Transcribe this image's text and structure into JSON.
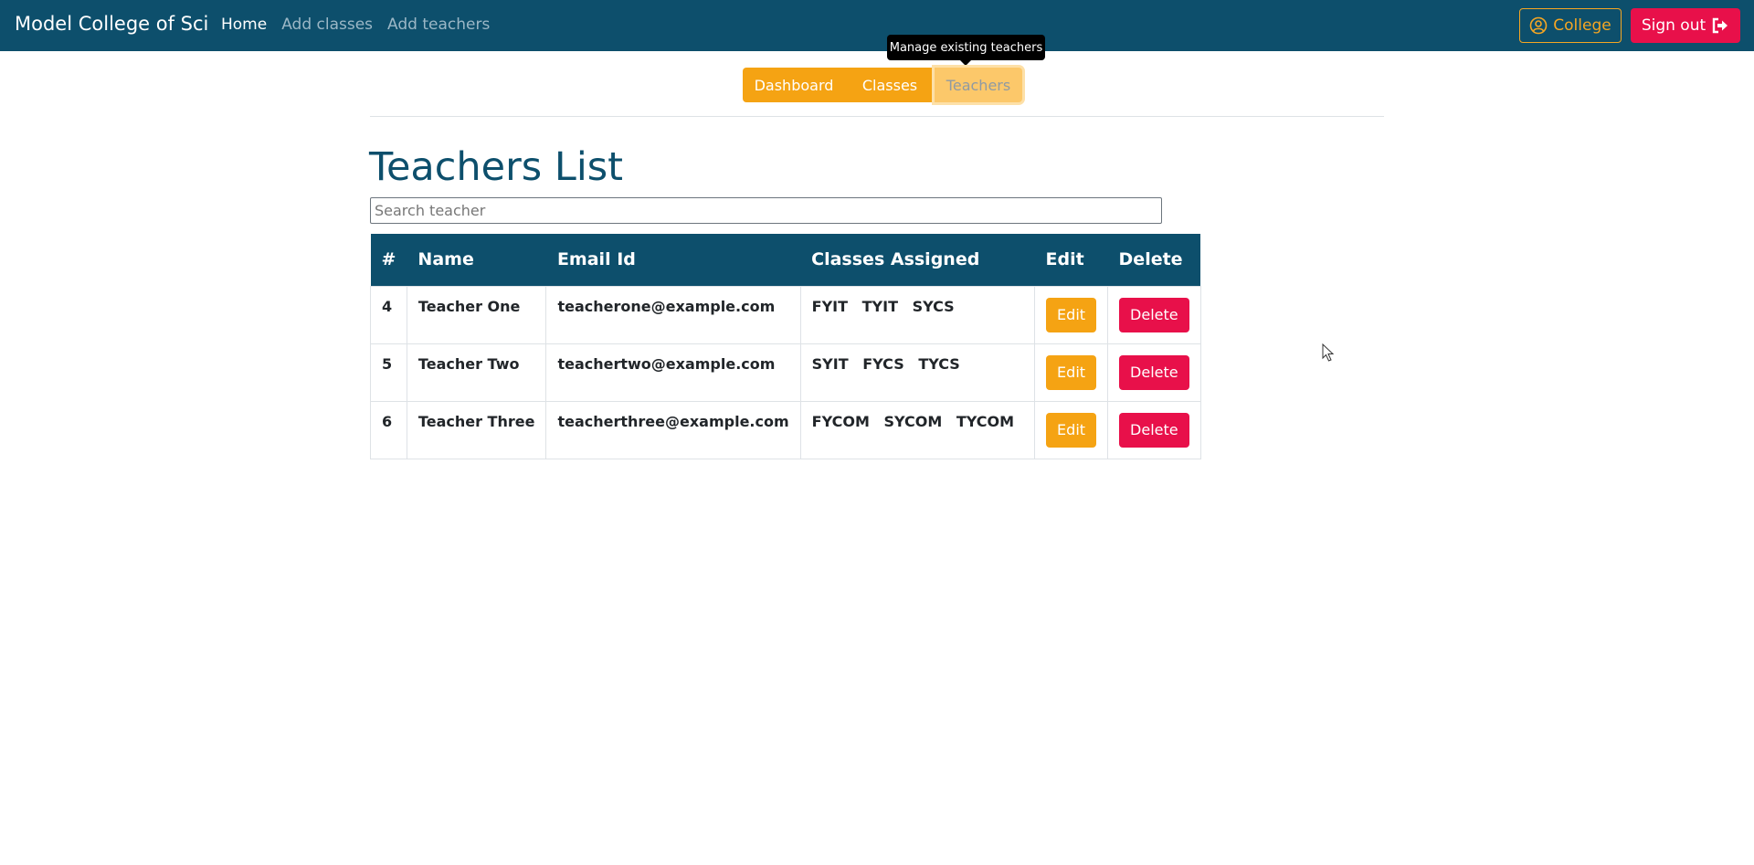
{
  "navbar": {
    "brand": "Model College of Sci",
    "links": [
      {
        "label": "Home",
        "active": true
      },
      {
        "label": "Add classes",
        "active": false
      },
      {
        "label": "Add teachers",
        "active": false
      }
    ],
    "college_button": {
      "label": "College",
      "icon": "user-circle-icon"
    },
    "signout_button": {
      "label": "Sign out",
      "icon": "sign-out-icon"
    }
  },
  "tooltip": "Manage existing teachers",
  "tabs": [
    {
      "label": "Dashboard"
    },
    {
      "label": "Classes"
    },
    {
      "label": "Teachers",
      "active": true
    }
  ],
  "page": {
    "title": "Teachers List",
    "search_placeholder": "Search teacher"
  },
  "table": {
    "headers": [
      "#",
      "Name",
      "Email Id",
      "Classes Assigned",
      "Edit",
      "Delete"
    ],
    "rows": [
      {
        "id": "4",
        "name": "Teacher One",
        "email": "teacherone@example.com",
        "classes": [
          "FYIT",
          "TYIT",
          "SYCS"
        ],
        "edit": "Edit",
        "delete": "Delete"
      },
      {
        "id": "5",
        "name": "Teacher Two",
        "email": "teachertwo@example.com",
        "classes": [
          "SYIT",
          "FYCS",
          "TYCS"
        ],
        "edit": "Edit",
        "delete": "Delete"
      },
      {
        "id": "6",
        "name": "Teacher Three",
        "email": "teacherthree@example.com",
        "classes": [
          "FYCOM",
          "SYCOM",
          "TYCOM"
        ],
        "edit": "Edit",
        "delete": "Delete"
      }
    ]
  },
  "colors": {
    "navbar": "#0d4f6c",
    "accent": "#f5a313",
    "danger": "#e8104a"
  }
}
